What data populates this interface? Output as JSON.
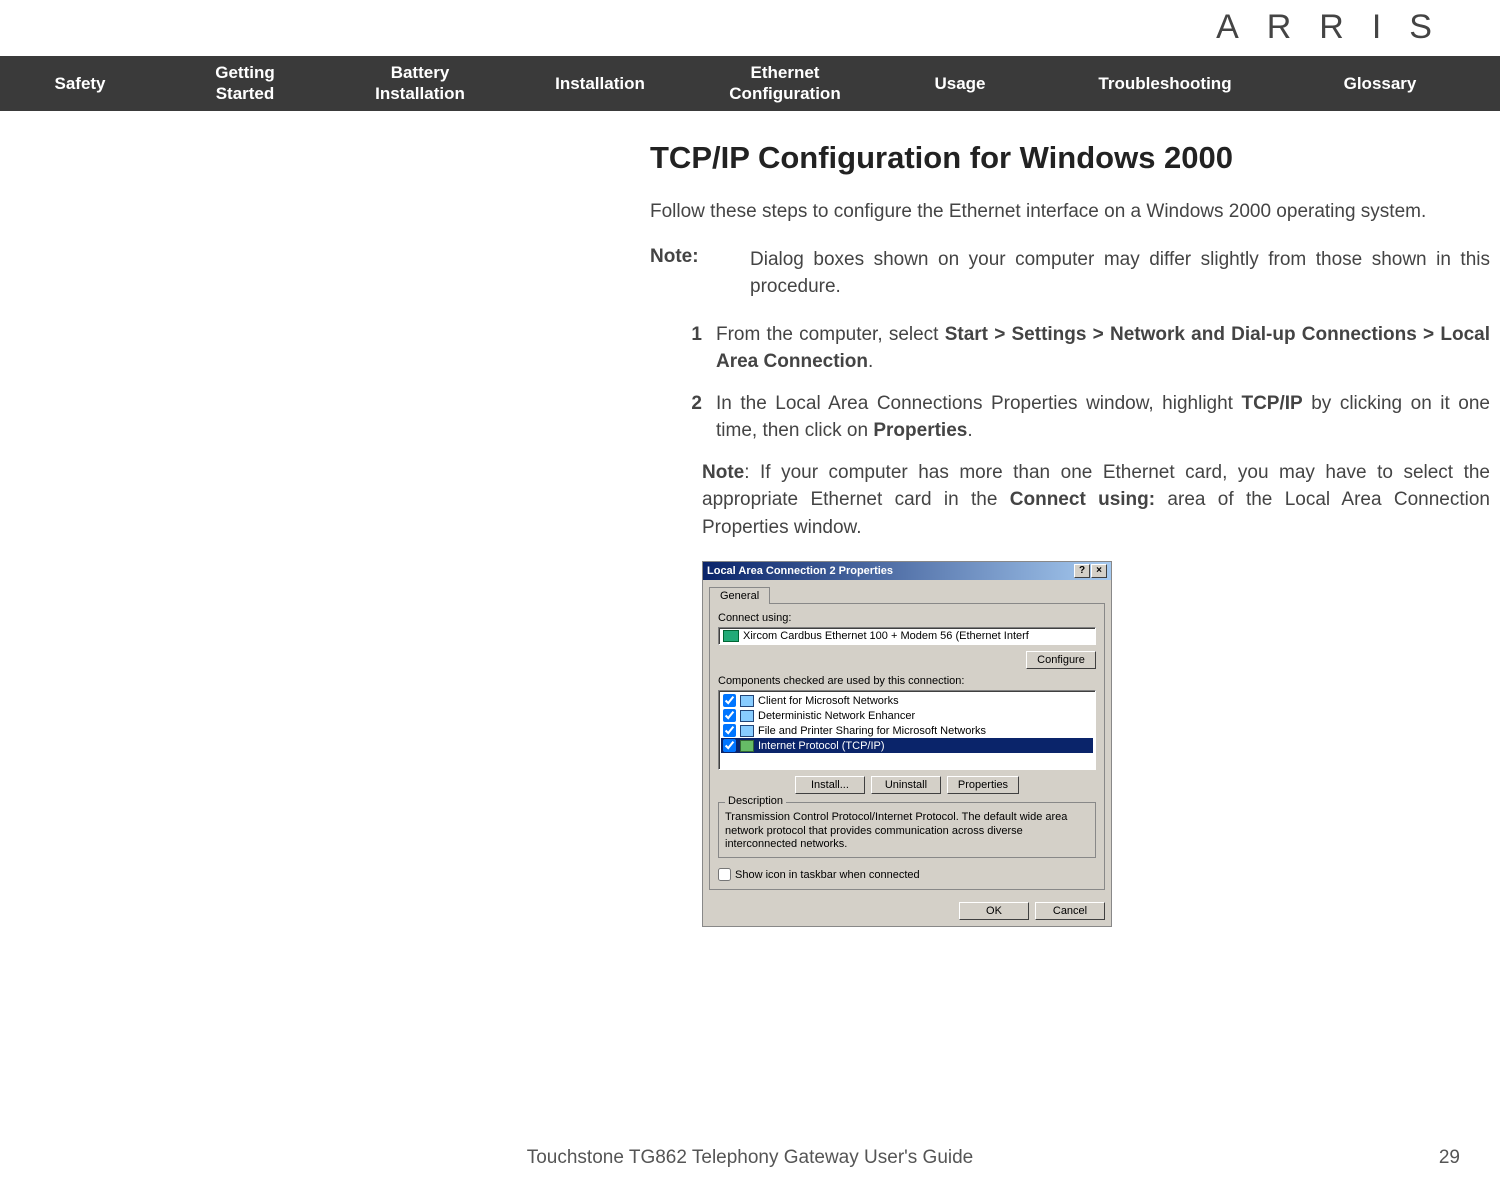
{
  "logo": "ARRIS",
  "nav": {
    "safety": "Safety",
    "getting_started": "Getting\nStarted",
    "battery_installation": "Battery\nInstallation",
    "installation": "Installation",
    "ethernet_configuration": "Ethernet\nConfiguration",
    "usage": "Usage",
    "troubleshooting": "Troubleshooting",
    "glossary": "Glossary"
  },
  "heading": "TCP/IP Configuration for Windows 2000",
  "intro": "Follow these steps to configure the Ethernet interface on a Windows 2000 operating system.",
  "note_label": "Note:",
  "note_text": "Dialog boxes shown on your computer may differ slightly from those shown in this procedure.",
  "steps": {
    "s1_num": "1",
    "s1_pre": "From the computer, select ",
    "s1_bold": "Start > Settings > Network and Dial-up Connections > Local Area Connection",
    "s1_post": ".",
    "s2_num": "2",
    "s2_pre": "In the Local Area Connections Properties window, highlight ",
    "s2_bold1": "TCP/IP",
    "s2_mid": " by clicking on it one time, then click on ",
    "s2_bold2": "Properties",
    "s2_post": "."
  },
  "subnote": {
    "label": "Note",
    "pre": ": If your computer has more than one Ethernet card, you may have to select the appropriate Ethernet card in the ",
    "bold": "Connect using:",
    "post": " area of the Local Area Connection Properties window."
  },
  "dialog": {
    "title": "Local Area Connection 2 Properties",
    "help_btn": "?",
    "close_btn": "×",
    "tab": "General",
    "connect_using_label": "Connect using:",
    "adapter": "Xircom Cardbus Ethernet 100 + Modem 56 (Ethernet Interf",
    "configure_btn": "Configure",
    "components_label": "Components checked are used by this connection:",
    "components": [
      "Client for Microsoft Networks",
      "Deterministic Network Enhancer",
      "File and Printer Sharing for Microsoft Networks",
      "Internet Protocol (TCP/IP)"
    ],
    "install_btn": "Install...",
    "uninstall_btn": "Uninstall",
    "properties_btn": "Properties",
    "description_label": "Description",
    "description_text": "Transmission Control Protocol/Internet Protocol. The default wide area network protocol that provides communication across diverse interconnected networks.",
    "show_icon": "Show icon in taskbar when connected",
    "ok_btn": "OK",
    "cancel_btn": "Cancel"
  },
  "footer": "Touchstone TG862 Telephony Gateway User's Guide",
  "page_number": "29"
}
